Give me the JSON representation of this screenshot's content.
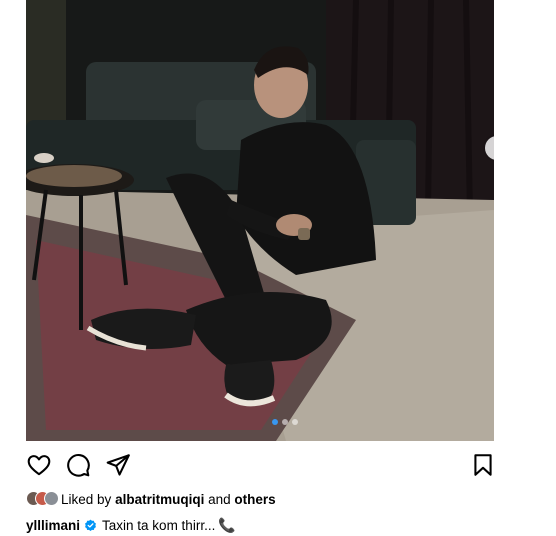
{
  "post": {
    "image_alt": "Man sitting cross-legged on a rug using a phone",
    "carousel": {
      "count": 3,
      "active_index": 0
    }
  },
  "icons": {
    "like": "heart-icon",
    "comment": "comment-bubble-icon",
    "share": "paper-plane-icon",
    "save": "bookmark-icon",
    "next": "chevron-right-icon",
    "verified": "verified-badge-icon",
    "emoji": "telephone-receiver-emoji"
  },
  "likes": {
    "prefix": "Liked by",
    "first_user": "albatritmuqiqi",
    "conjunction": "and",
    "others": "others"
  },
  "caption": {
    "username": "ylllimani",
    "text": "Taxin ta kom thirr...",
    "emoji": "📞"
  },
  "colors": {
    "accent": "#3897f0",
    "verified": "#0095f6",
    "text": "#000000"
  }
}
